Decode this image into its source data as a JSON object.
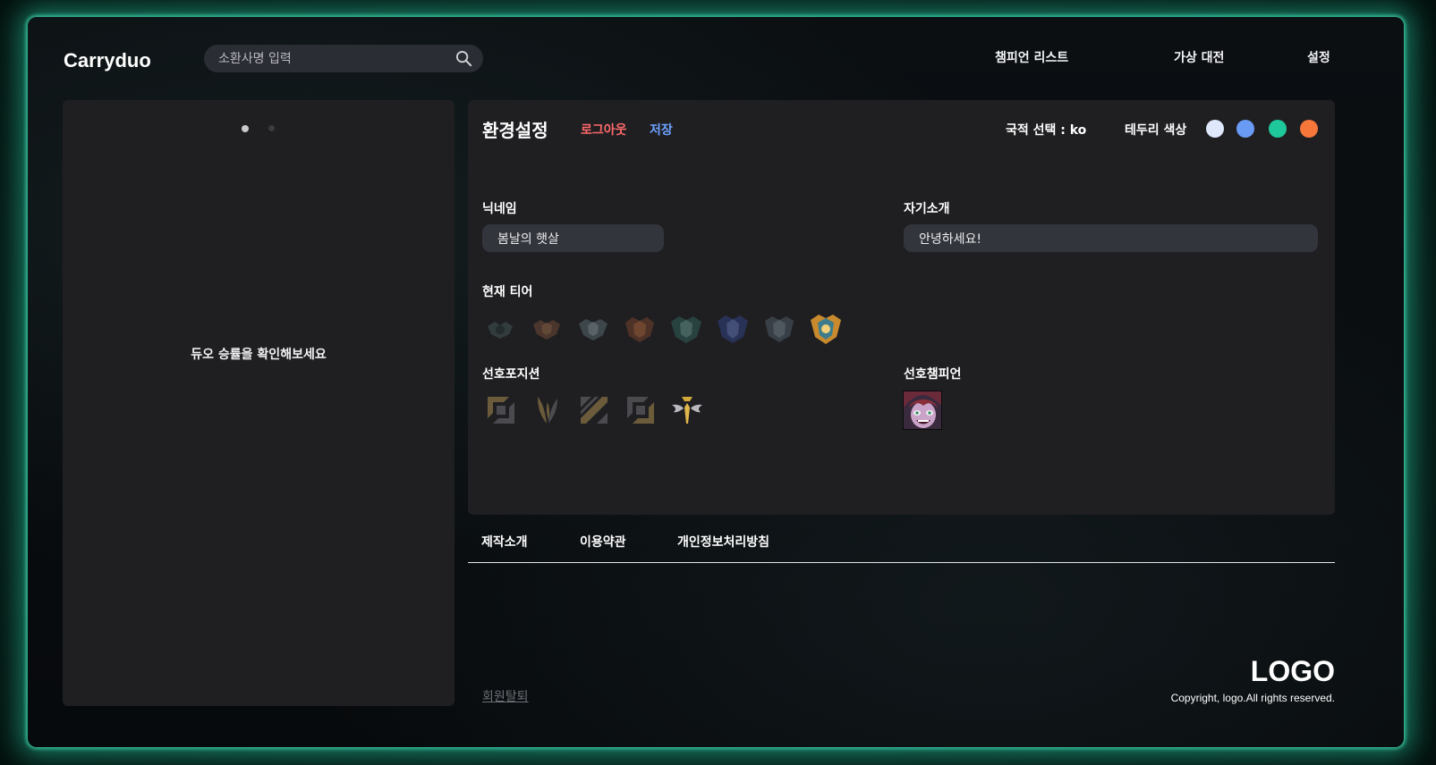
{
  "header": {
    "brand": "Carryduo",
    "search": {
      "placeholder": "소환사명 입력",
      "value": ""
    },
    "nav": [
      "챔피언 리스트",
      "가상 대전",
      "설정"
    ]
  },
  "left_panel": {
    "carousel_pages": 2,
    "carousel_active": 1,
    "message": "듀오 승률을 확인해보세요"
  },
  "settings": {
    "title": "환경설정",
    "logout_label": "로그아웃",
    "save_label": "저장",
    "country_label": "국적 선택 : ko",
    "border_color_label": "테두리 색상",
    "border_colors": [
      "#dfe8fb",
      "#6a9bf4",
      "#1fc89a",
      "#f7773b"
    ],
    "nickname": {
      "label": "닉네임",
      "value": "봄날의 햇살"
    },
    "intro": {
      "label": "자기소개",
      "value": "안녕하세요!"
    },
    "tier": {
      "label": "현재 티어",
      "icons": [
        "iron-tier-icon",
        "bronze-tier-icon",
        "silver-tier-icon",
        "gold-tier-icon",
        "platinum-tier-icon",
        "diamond-tier-icon",
        "master-tier-icon",
        "challenger-tier-icon"
      ],
      "selected": "challenger-tier-icon"
    },
    "position": {
      "label": "선호포지션",
      "icons": [
        "top-position-icon",
        "jungle-position-icon",
        "mid-position-icon",
        "bottom-position-icon",
        "support-position-icon"
      ],
      "selected": "support-position-icon"
    },
    "champion": {
      "label": "선호챔피언",
      "icon": "champion-portrait"
    }
  },
  "footer": {
    "links": [
      "제작소개",
      "이용약관",
      "개인정보처리방침"
    ],
    "withdraw_label": "회원탈퇴",
    "logo": "LOGO",
    "copyright": "Copyright, logo.All rights reserved."
  }
}
